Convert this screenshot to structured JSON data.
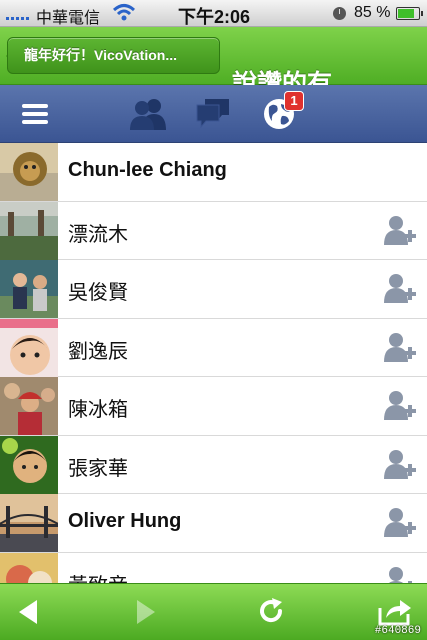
{
  "status_bar": {
    "carrier": "中華電信",
    "time": "下午2:06",
    "battery_percent": "85 %",
    "battery_level": 0.85
  },
  "app_bar": {
    "back_label": "龍年好行！VicoVation...",
    "title": "說讚的有"
  },
  "toolbar": {
    "notification_count": "1"
  },
  "likers": [
    {
      "name": "Chun-lee Chiang",
      "latin": true,
      "show_add": false
    },
    {
      "name": "漂流木",
      "latin": false,
      "show_add": true
    },
    {
      "name": "吳俊賢",
      "latin": false,
      "show_add": true
    },
    {
      "name": "劉逸辰",
      "latin": false,
      "show_add": true
    },
    {
      "name": "陳冰箱",
      "latin": false,
      "show_add": true
    },
    {
      "name": "張家華",
      "latin": false,
      "show_add": true
    },
    {
      "name": "Oliver Hung",
      "latin": true,
      "show_add": true
    },
    {
      "name": "黃致音",
      "latin": false,
      "show_add": true
    }
  ],
  "bottom_bar": {
    "watermark": "#640869"
  },
  "colors": {
    "green_bar": "#4fae24",
    "facebook_blue": "#3b5593",
    "badge_red": "#e0312e"
  }
}
